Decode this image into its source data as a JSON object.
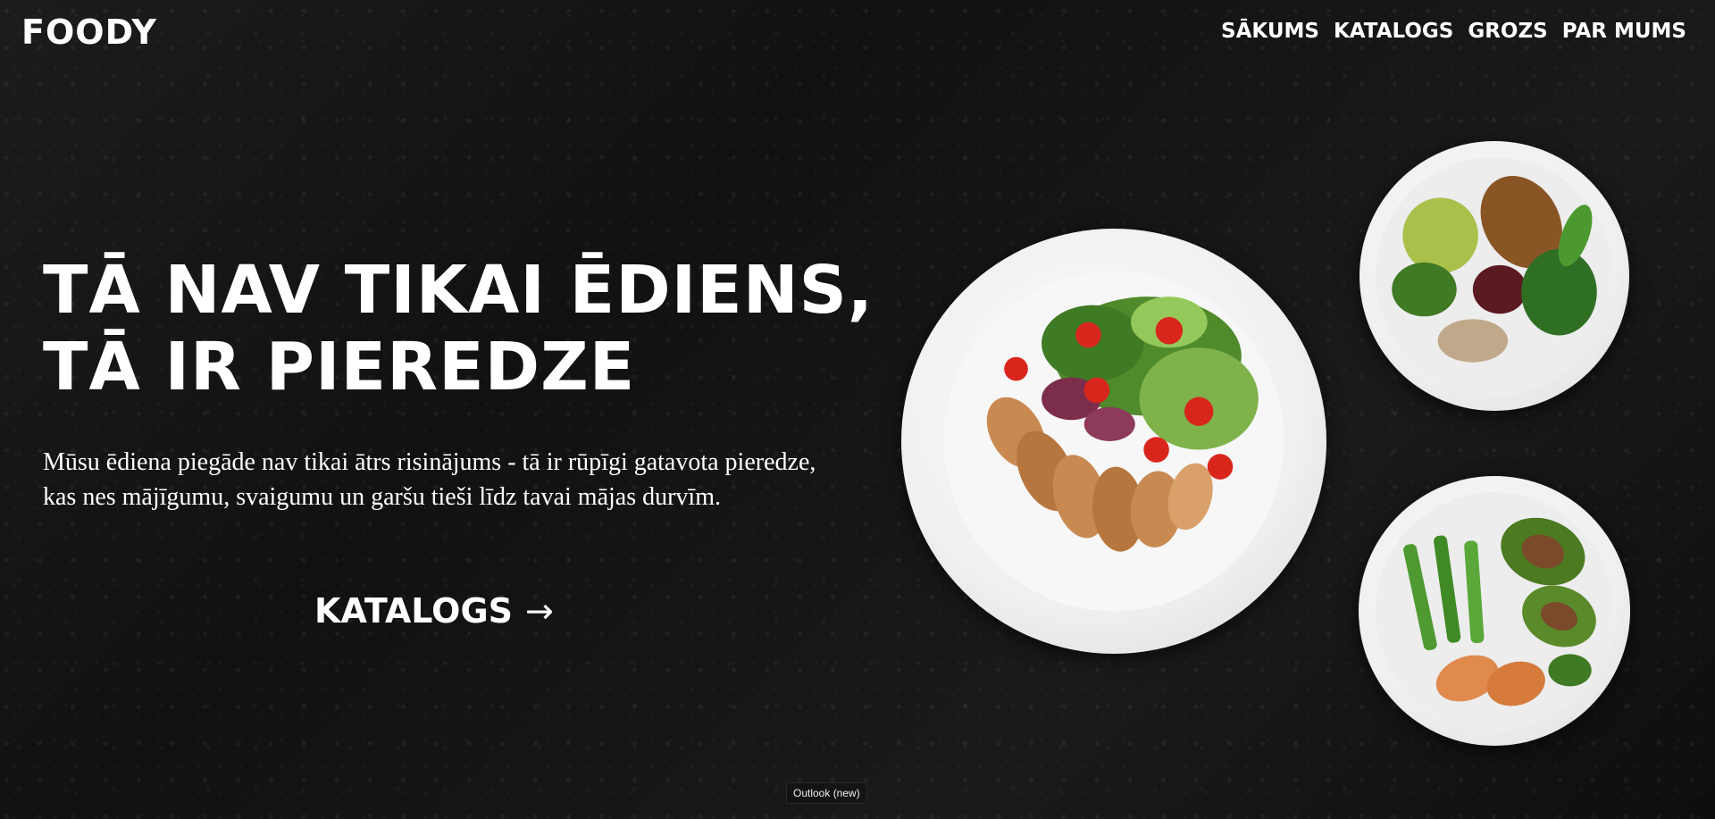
{
  "brand": {
    "logo": "FOODY"
  },
  "nav": {
    "items": [
      {
        "label": "SĀKUMS"
      },
      {
        "label": "KATALOGS"
      },
      {
        "label": "GROZS"
      },
      {
        "label": "PAR MUMS"
      }
    ]
  },
  "hero": {
    "headline_line1": "TĀ NAV TIKAI ĒDIENS,",
    "headline_line2": "TĀ IR PIEREDZE",
    "description": "Mūsu ēdiena piegāde nav tikai ātrs risinājums - tā ir rūpīgi gatavota pieredze, kas nes mājīgumu, svaigumu un garšu tieši līdz tavai mājas durvīm.",
    "cta_label": "KATALOGS",
    "cta_arrow": "→"
  },
  "tooltip": {
    "text": "Outlook (new)"
  },
  "colors": {
    "background": "#151515",
    "text": "#ffffff",
    "plate": "#f2f2f2"
  }
}
